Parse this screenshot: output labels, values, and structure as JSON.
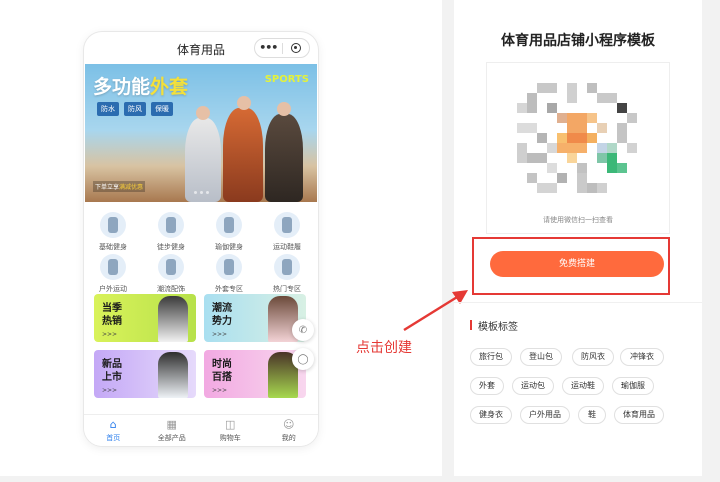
{
  "preview": {
    "phone_title": "体育用品",
    "capsule_more": "•••",
    "banner": {
      "headline_a": "多功能",
      "headline_b": "外套",
      "sports": "SPORTS",
      "tags": [
        "防水",
        "防风",
        "保暖"
      ],
      "caption_a": "下单立享",
      "caption_b": "满减优惠"
    },
    "categories": [
      "基础健身",
      "徒步健身",
      "瑜伽健身",
      "运动鞋履",
      "户外运动",
      "潮流配饰",
      "外套专区",
      "热门专区"
    ],
    "promos": [
      {
        "line1": "当季",
        "line2": "热销",
        "more": ">>>"
      },
      {
        "line1": "潮流",
        "line2": "势力",
        "more": ">>>"
      },
      {
        "line1": "新品",
        "line2": "上市",
        "more": ">>>"
      },
      {
        "line1": "时尚",
        "line2": "百搭",
        "more": ">>>"
      }
    ],
    "tabbar": [
      {
        "label": "首页",
        "icon": "home-icon",
        "active": true
      },
      {
        "label": "全部产品",
        "icon": "grid-icon",
        "active": false
      },
      {
        "label": "购物车",
        "icon": "cart-icon",
        "active": false
      },
      {
        "label": "我的",
        "icon": "user-icon",
        "active": false
      }
    ]
  },
  "annotation": "点击创建",
  "template": {
    "title": "体育用品店铺小程序模板",
    "qr_hint": "请使用微信扫一扫查看",
    "free_button": "免费搭建",
    "tags_title": "模板标签",
    "tags": [
      "旅行包",
      "登山包",
      "防风衣",
      "冲锋衣",
      "外套",
      "运动包",
      "运动鞋",
      "瑜伽服",
      "健身衣",
      "户外用品",
      "鞋",
      "体育用品"
    ]
  },
  "colors": {
    "accent": "#ff6a3d",
    "annotation_red": "#e53935",
    "tab_active": "#2f80ed"
  }
}
